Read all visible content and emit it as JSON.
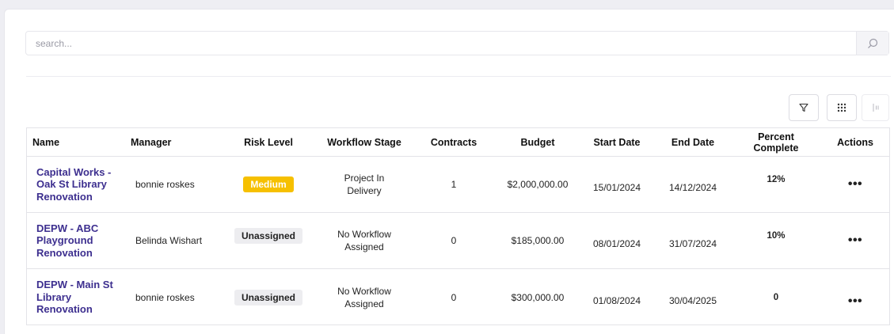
{
  "search": {
    "placeholder": "search..."
  },
  "table": {
    "headers": {
      "name": "Name",
      "manager": "Manager",
      "risk_level": "Risk Level",
      "workflow_stage": "Workflow Stage",
      "contracts": "Contracts",
      "budget": "Budget",
      "start_date": "Start Date",
      "end_date": "End Date",
      "percent_complete_1": "Percent",
      "percent_complete_2": "Complete",
      "actions": "Actions"
    },
    "rows": [
      {
        "name_lines": [
          "Capital Works -",
          "Oak St Library",
          "Renovation"
        ],
        "manager": "bonnie roskes",
        "risk_level": "Medium",
        "workflow_lines": [
          "Project In",
          "Delivery"
        ],
        "contracts": "1",
        "budget": "$2,000,000.00",
        "start_date": "15/01/2024",
        "end_date": "14/12/2024",
        "percent_complete": "12%",
        "actions": "•••"
      },
      {
        "name_lines": [
          "DEPW - ABC",
          "Playground",
          "Renovation"
        ],
        "manager": "Belinda Wishart",
        "risk_level": "Unassigned",
        "workflow_lines": [
          "No Workflow",
          "Assigned"
        ],
        "contracts": "0",
        "budget": "$185,000.00",
        "start_date": "08/01/2024",
        "end_date": "31/07/2024",
        "percent_complete": "10%",
        "actions": "•••"
      },
      {
        "name_lines": [
          "DEPW - Main St",
          "Library",
          "Renovation"
        ],
        "manager": "bonnie roskes",
        "risk_level": "Unassigned",
        "workflow_lines": [
          "No Workflow",
          "Assigned"
        ],
        "contracts": "0",
        "budget": "$300,000.00",
        "start_date": "01/08/2024",
        "end_date": "30/04/2025",
        "percent_complete": "0",
        "actions": "•••"
      }
    ]
  },
  "toolbar": {
    "filter_icon": "filter-icon",
    "grid_icon": "grid-dots-icon",
    "columns_icon": "columns-icon"
  },
  "colors": {
    "link": "#3d2f8f",
    "medium_badge": "#f6c000",
    "unassigned_badge": "#ededf0"
  }
}
